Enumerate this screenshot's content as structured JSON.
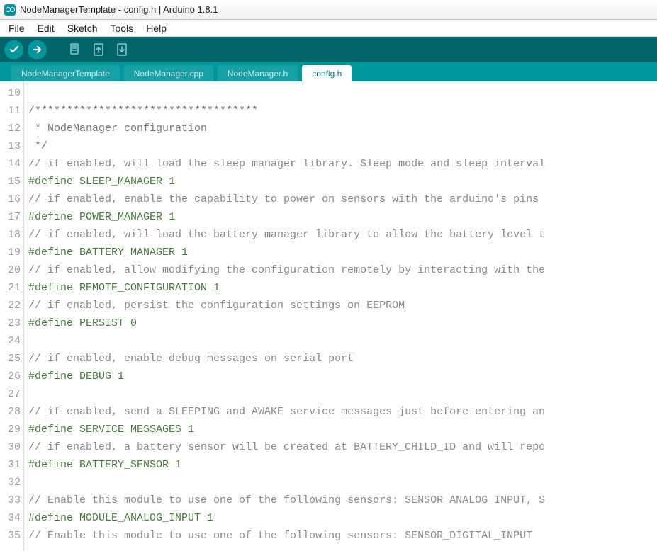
{
  "window": {
    "title": "NodeManagerTemplate - config.h | Arduino 1.8.1"
  },
  "menu": {
    "items": [
      "File",
      "Edit",
      "Sketch",
      "Tools",
      "Help"
    ]
  },
  "toolbar": {
    "verify": "verify",
    "upload": "upload",
    "new": "new",
    "open": "open",
    "save": "save"
  },
  "tabs": {
    "items": [
      {
        "label": "NodeManagerTemplate",
        "active": false
      },
      {
        "label": "NodeManager.cpp",
        "active": false
      },
      {
        "label": "NodeManager.h",
        "active": false
      },
      {
        "label": "config.h",
        "active": true
      }
    ]
  },
  "editor": {
    "first_line": 10,
    "lines": [
      {
        "n": 10,
        "segs": []
      },
      {
        "n": 11,
        "segs": [
          {
            "cls": "c-comment-star",
            "t": "/***********************************"
          }
        ]
      },
      {
        "n": 12,
        "segs": [
          {
            "cls": "c-comment-star",
            "t": " * NodeManager configuration"
          }
        ]
      },
      {
        "n": 13,
        "segs": [
          {
            "cls": "c-comment-star",
            "t": " */"
          }
        ]
      },
      {
        "n": 14,
        "segs": [
          {
            "cls": "c-comment-grey",
            "t": "// if enabled, will load the sleep manager library. Sleep mode and sleep interval"
          }
        ]
      },
      {
        "n": 15,
        "segs": [
          {
            "cls": "c-define",
            "t": "#define SLEEP_MANAGER 1"
          }
        ]
      },
      {
        "n": 16,
        "segs": [
          {
            "cls": "c-comment-grey",
            "t": "// if enabled, enable the capability to power on sensors with the arduino's pins"
          }
        ]
      },
      {
        "n": 17,
        "segs": [
          {
            "cls": "c-define",
            "t": "#define POWER_MANAGER 1"
          }
        ]
      },
      {
        "n": 18,
        "segs": [
          {
            "cls": "c-comment-grey",
            "t": "// if enabled, will load the battery manager library to allow the battery level t"
          }
        ]
      },
      {
        "n": 19,
        "segs": [
          {
            "cls": "c-define",
            "t": "#define BATTERY_MANAGER 1"
          }
        ]
      },
      {
        "n": 20,
        "segs": [
          {
            "cls": "c-comment-grey",
            "t": "// if enabled, allow modifying the configuration remotely by interacting with the"
          }
        ]
      },
      {
        "n": 21,
        "segs": [
          {
            "cls": "c-define",
            "t": "#define REMOTE_CONFIGURATION 1"
          }
        ]
      },
      {
        "n": 22,
        "segs": [
          {
            "cls": "c-comment-grey",
            "t": "// if enabled, persist the configuration settings on EEPROM"
          }
        ]
      },
      {
        "n": 23,
        "segs": [
          {
            "cls": "c-define",
            "t": "#define PERSIST 0"
          }
        ]
      },
      {
        "n": 24,
        "segs": []
      },
      {
        "n": 25,
        "segs": [
          {
            "cls": "c-comment-grey",
            "t": "// if enabled, enable debug messages on serial port"
          }
        ]
      },
      {
        "n": 26,
        "segs": [
          {
            "cls": "c-define",
            "t": "#define DEBUG 1"
          }
        ]
      },
      {
        "n": 27,
        "segs": []
      },
      {
        "n": 28,
        "segs": [
          {
            "cls": "c-comment-grey",
            "t": "// if enabled, send a SLEEPING and AWAKE service messages just before entering an"
          }
        ]
      },
      {
        "n": 29,
        "segs": [
          {
            "cls": "c-define",
            "t": "#define SERVICE_MESSAGES 1"
          }
        ]
      },
      {
        "n": 30,
        "segs": [
          {
            "cls": "c-comment-grey",
            "t": "// if enabled, a battery sensor will be created at BATTERY_CHILD_ID and will repo"
          }
        ]
      },
      {
        "n": 31,
        "segs": [
          {
            "cls": "c-define",
            "t": "#define BATTERY_SENSOR 1"
          }
        ]
      },
      {
        "n": 32,
        "segs": []
      },
      {
        "n": 33,
        "segs": [
          {
            "cls": "c-comment-grey",
            "t": "// Enable this module to use one of the following sensors: SENSOR_ANALOG_INPUT, S"
          }
        ]
      },
      {
        "n": 34,
        "segs": [
          {
            "cls": "c-define",
            "t": "#define MODULE_ANALOG_INPUT 1"
          }
        ]
      },
      {
        "n": 35,
        "segs": [
          {
            "cls": "c-comment-grey",
            "t": "// Enable this module to use one of the following sensors: SENSOR_DIGITAL_INPUT"
          }
        ]
      }
    ]
  }
}
